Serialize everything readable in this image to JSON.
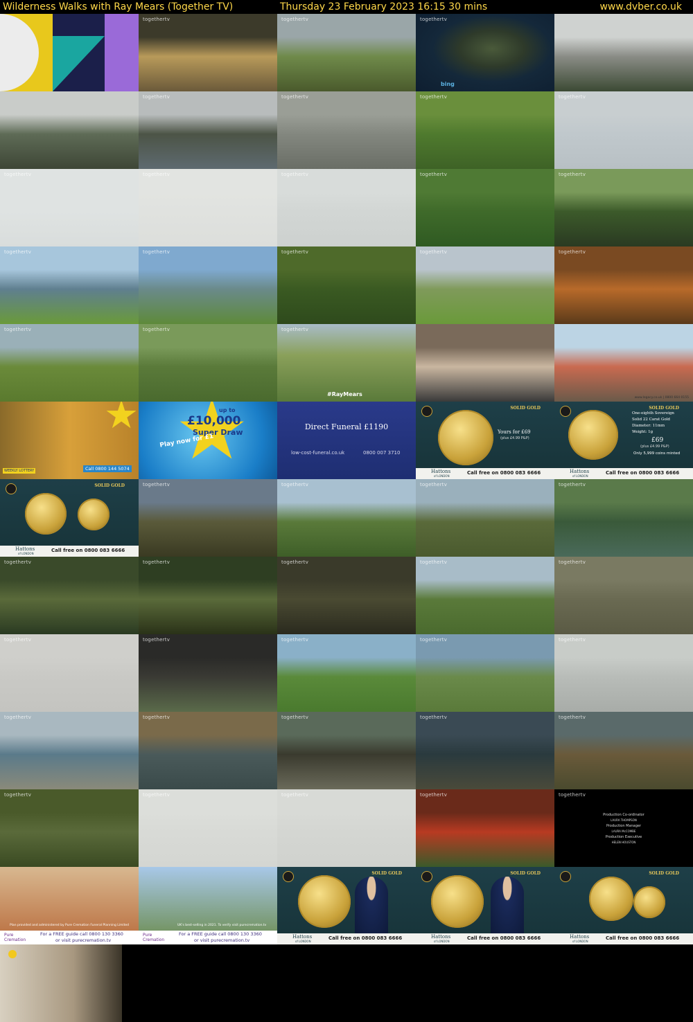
{
  "header": {
    "title": "Wilderness Walks with Ray Mears (Together TV)",
    "datetime": "Thursday 23 February 2023  16:15  30 mins",
    "site": "www.dvber.co.uk"
  },
  "watermark": "togethertv",
  "captions": {
    "bing": "bing",
    "hashtag": "#RayMears",
    "lottery_call": "Call 0800 144 5074",
    "lottery_weekly": "WEEKLY LOTTERY",
    "superdraw_up_to": "up to",
    "superdraw_amount": "£10,000",
    "superdraw_name": "Super Draw",
    "superdraw_play": "Play now for £1",
    "funeral_title": "Direct Funeral £1190",
    "funeral_site": "low-cost-funeral.co.uk",
    "funeral_phone": "0800 007 3710",
    "coin_yours": "Yours for £69",
    "coin_pp": "(plus £4.99 P&P)",
    "coin_call": "Call free on 0800 083 6666",
    "coin_brand": "Hattons",
    "coin_brand_sub": "of LONDON",
    "coin_gold": "SOLID GOLD",
    "coin_specs": [
      "One-eighth Sovereign",
      "Solid 22 Carat Gold",
      "Diameter: 11mm",
      "Weight: 1g"
    ],
    "coin_price": "£69",
    "coin_price_pp": "(plus £4.99 P&P)",
    "coin_minted": "Only 5,999 coins minted",
    "credits": [
      "Production Co-ordinator",
      "LAURA THOMPSON",
      "Production Manager",
      "LAURA McCOMBE",
      "Production Executive",
      "HELEN HOUSTON"
    ],
    "cremation_brand": "Pure Cremation",
    "cremation_guide": "For a FREE guide call 0800 130 3360",
    "cremation_visit": "or visit purecremation.tv",
    "cremation_plan": "Plan provided and administered by Pure Cremation Funeral Planning Limited",
    "cremation_best": "UK's best-selling in 2021. To verify visit purecremation.tv",
    "ad_site": "www.legacy.co.uk | 0800 664 0155"
  },
  "tiles": [
    {
      "kind": "logo"
    },
    {
      "kind": "scene",
      "c": [
        "#3c3a2a",
        "#b89a5a",
        "#6b5a3a"
      ],
      "wm": true
    },
    {
      "kind": "scene",
      "c": [
        "#9aa6a8",
        "#6f8a4a",
        "#4a5a2c"
      ],
      "wm": true
    },
    {
      "kind": "map",
      "wm": true
    },
    {
      "kind": "scene",
      "c": [
        "#cfd2d0",
        "#8a8c86",
        "#3c4a34"
      ]
    },
    {
      "kind": "scene",
      "c": [
        "#c9ccc9",
        "#5e6b56",
        "#3e4636"
      ]
    },
    {
      "kind": "scene",
      "c": [
        "#b8bcbc",
        "#4c5446",
        "#5e6a70"
      ],
      "wm": true
    },
    {
      "kind": "scene",
      "c": [
        "#9a9e96",
        "#83877f",
        "#6a6e66"
      ],
      "wm": true
    },
    {
      "kind": "scene",
      "c": [
        "#6a8f3c",
        "#4f7a2e",
        "#3e6226"
      ],
      "wm": true
    },
    {
      "kind": "scene",
      "c": [
        "#c8ced0",
        "#c0c8cc",
        "#b8c0c4"
      ],
      "wm": true
    },
    {
      "kind": "scene",
      "c": [
        "#dfe3e2",
        "#dfe3e2",
        "#d9dddc"
      ],
      "wm": true
    },
    {
      "kind": "scene",
      "c": [
        "#e2e4e1",
        "#e0e2df",
        "#dcdedb"
      ],
      "wm": true
    },
    {
      "kind": "scene",
      "c": [
        "#d8dcda",
        "#d2d6d4",
        "#cdd1cf"
      ],
      "wm": true
    },
    {
      "kind": "scene",
      "c": [
        "#4f7a34",
        "#3f6a2a",
        "#2f5a22"
      ],
      "wm": true
    },
    {
      "kind": "scene",
      "c": [
        "#7a9a5a",
        "#3c5a2a",
        "#2a3a22"
      ],
      "wm": true
    },
    {
      "kind": "scene",
      "c": [
        "#a7c6dc",
        "#5f7f8f",
        "#6a9a3a"
      ],
      "wm": true
    },
    {
      "kind": "scene",
      "c": [
        "#7fa9cf",
        "#6a8a8a",
        "#5e8a3a"
      ],
      "wm": true
    },
    {
      "kind": "scene",
      "c": [
        "#4e6a2a",
        "#3a5a22",
        "#2e4a1c"
      ],
      "wm": true
    },
    {
      "kind": "scene",
      "c": [
        "#b9c4cc",
        "#7f9a5a",
        "#6a9a3a"
      ],
      "wm": true
    },
    {
      "kind": "scene",
      "c": [
        "#7a4a22",
        "#b86a2a",
        "#5a3a1a"
      ],
      "wm": true
    },
    {
      "kind": "scene",
      "c": [
        "#9ab0b8",
        "#6a8a3a",
        "#5a7a2e"
      ],
      "wm": true
    },
    {
      "kind": "scene",
      "c": [
        "#7a9a5a",
        "#5a7a3a",
        "#4a6a2e"
      ],
      "wm": true
    },
    {
      "kind": "hashtag",
      "wm": true
    },
    {
      "kind": "scene",
      "c": [
        "#7a6a5a",
        "#c9b6a0",
        "#3a3a3a"
      ]
    },
    {
      "kind": "scene",
      "c": [
        "#bcd4e4",
        "#c96a50",
        "#6a5a4a"
      ],
      "site": true
    },
    {
      "kind": "lottery"
    },
    {
      "kind": "superdraw"
    },
    {
      "kind": "funeral"
    },
    {
      "kind": "coin1"
    },
    {
      "kind": "coin2"
    },
    {
      "kind": "coin3"
    },
    {
      "kind": "scene",
      "c": [
        "#6a7a8a",
        "#5a5a3a",
        "#3a3a22"
      ],
      "wm": true
    },
    {
      "kind": "scene",
      "c": [
        "#a8c0d0",
        "#5a7a3a",
        "#3e5e28"
      ],
      "wm": true
    },
    {
      "kind": "scene",
      "c": [
        "#9ab0bc",
        "#5a6a3a",
        "#4a5a2e"
      ],
      "wm": true
    },
    {
      "kind": "scene",
      "c": [
        "#5a7a4a",
        "#3a5a3a",
        "#4a6a5a"
      ],
      "wm": true
    },
    {
      "kind": "scene",
      "c": [
        "#3a4a2a",
        "#5a6a3a",
        "#2a3a22"
      ],
      "wm": true
    },
    {
      "kind": "scene",
      "c": [
        "#2e3e22",
        "#5a6a3a",
        "#2a3218"
      ],
      "wm": true
    },
    {
      "kind": "scene",
      "c": [
        "#3a3a2a",
        "#4a4a32",
        "#2a2a1e"
      ],
      "wm": true
    },
    {
      "kind": "scene",
      "c": [
        "#a8bcc8",
        "#5a7a3a",
        "#4a6a2e"
      ],
      "wm": true
    },
    {
      "kind": "scene",
      "c": [
        "#7a7a62",
        "#6a6a52",
        "#5a5a44"
      ],
      "wm": true
    },
    {
      "kind": "scene",
      "c": [
        "#cfcfcb",
        "#c9c9c5",
        "#c4c4c0"
      ],
      "wm": true
    },
    {
      "kind": "scene",
      "c": [
        "#2a2a28",
        "#3a3a34",
        "#5a6a4a"
      ],
      "wm": true
    },
    {
      "kind": "scene",
      "c": [
        "#8ab0c8",
        "#5a8a3a",
        "#4a7a2e"
      ],
      "wm": true
    },
    {
      "kind": "scene",
      "c": [
        "#7a9ab0",
        "#6a8a4a",
        "#5a7a3a"
      ],
      "wm": true
    },
    {
      "kind": "scene",
      "c": [
        "#c8ccc8",
        "#b8bcb8",
        "#a8aca8"
      ],
      "wm": true
    },
    {
      "kind": "scene",
      "c": [
        "#a9b8c0",
        "#5a7a8a",
        "#8a8a7a"
      ],
      "wm": true
    },
    {
      "kind": "scene",
      "c": [
        "#7a6a4a",
        "#4a5a5a",
        "#3a4a4a"
      ],
      "wm": true
    },
    {
      "kind": "scene",
      "c": [
        "#5a6a5a",
        "#3a3a2e",
        "#6a6a5a"
      ],
      "wm": true
    },
    {
      "kind": "scene",
      "c": [
        "#3a4a54",
        "#2a3a3e",
        "#4a4a3a"
      ],
      "wm": true
    },
    {
      "kind": "scene",
      "c": [
        "#5a6a6a",
        "#6a5a3a",
        "#4a4a2e"
      ],
      "wm": true
    },
    {
      "kind": "scene",
      "c": [
        "#4a5a2a",
        "#5a6a3a",
        "#3a4a22"
      ],
      "wm": true
    },
    {
      "kind": "scene",
      "c": [
        "#dcdeda",
        "#d8dad6",
        "#d4d6d2"
      ],
      "wm": true
    },
    {
      "kind": "scene",
      "c": [
        "#d8dad6",
        "#d4d6d2",
        "#d0d2ce"
      ],
      "wm": true
    },
    {
      "kind": "scene",
      "c": [
        "#6a2a1a",
        "#b83a22",
        "#3a5a2a"
      ],
      "wm": true
    },
    {
      "kind": "credits",
      "wm": true
    },
    {
      "kind": "cremation1"
    },
    {
      "kind": "cremation2"
    },
    {
      "kind": "coin4"
    },
    {
      "kind": "coin5"
    },
    {
      "kind": "coin6"
    },
    {
      "kind": "scene",
      "c": [
        "#d8d0c0",
        "#a89880",
        "#3a3428"
      ],
      "logo_small": true
    }
  ]
}
